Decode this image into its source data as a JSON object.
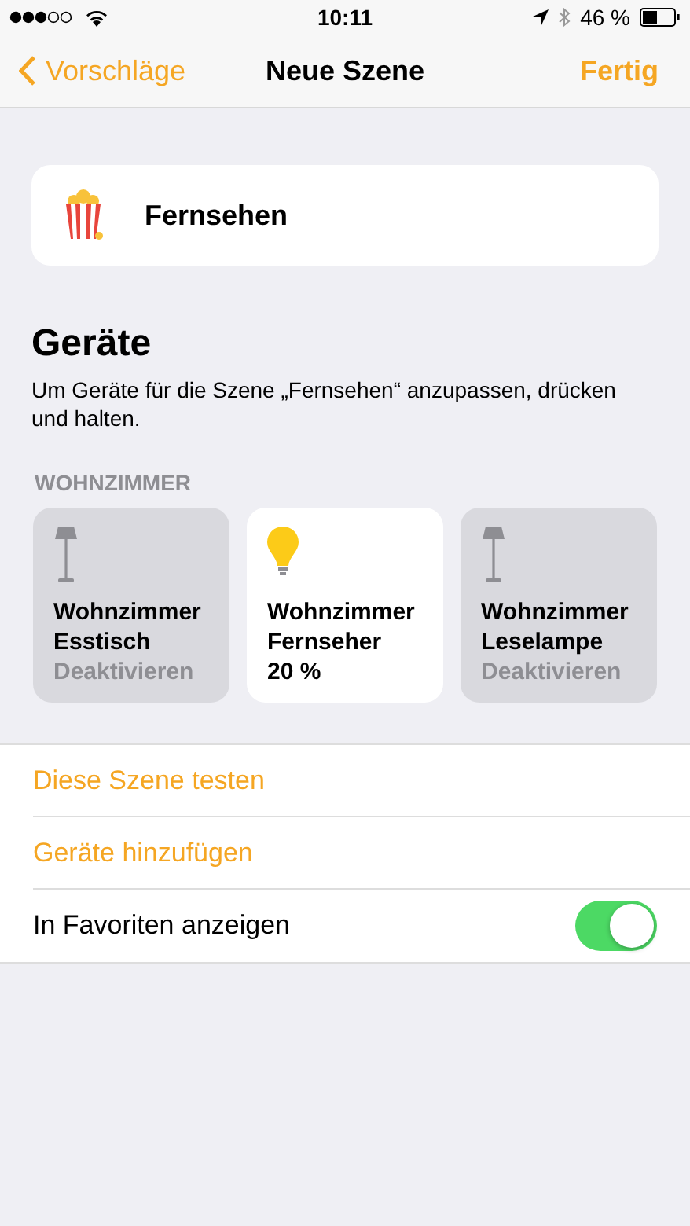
{
  "status_bar": {
    "time": "10:11",
    "battery": "46 %"
  },
  "nav": {
    "back": "Vorschläge",
    "title": "Neue Szene",
    "done": "Fertig"
  },
  "scene": {
    "name": "Fernsehen"
  },
  "devices_section": {
    "title": "Geräte",
    "description": "Um Geräte für die Szene „Fernsehen“ anzupassen, drücken und halten.",
    "room": "WOHNZIMMER",
    "devices": [
      {
        "kind": "lamp",
        "name": "Wohnzimmer Esstisch",
        "status": "Deaktivieren",
        "on": false
      },
      {
        "kind": "bulb",
        "name": "Wohnzimmer Fernseher",
        "status": "20 %",
        "on": true
      },
      {
        "kind": "lamp",
        "name": "Wohnzimmer Leselampe",
        "status": "Deaktivieren",
        "on": false
      }
    ]
  },
  "rows": [
    {
      "kind": "action",
      "label": "Diese Szene testen"
    },
    {
      "kind": "action",
      "label": "Geräte hinzufügen"
    },
    {
      "kind": "toggle",
      "label": "In Favoriten anzeigen",
      "on": true
    }
  ]
}
